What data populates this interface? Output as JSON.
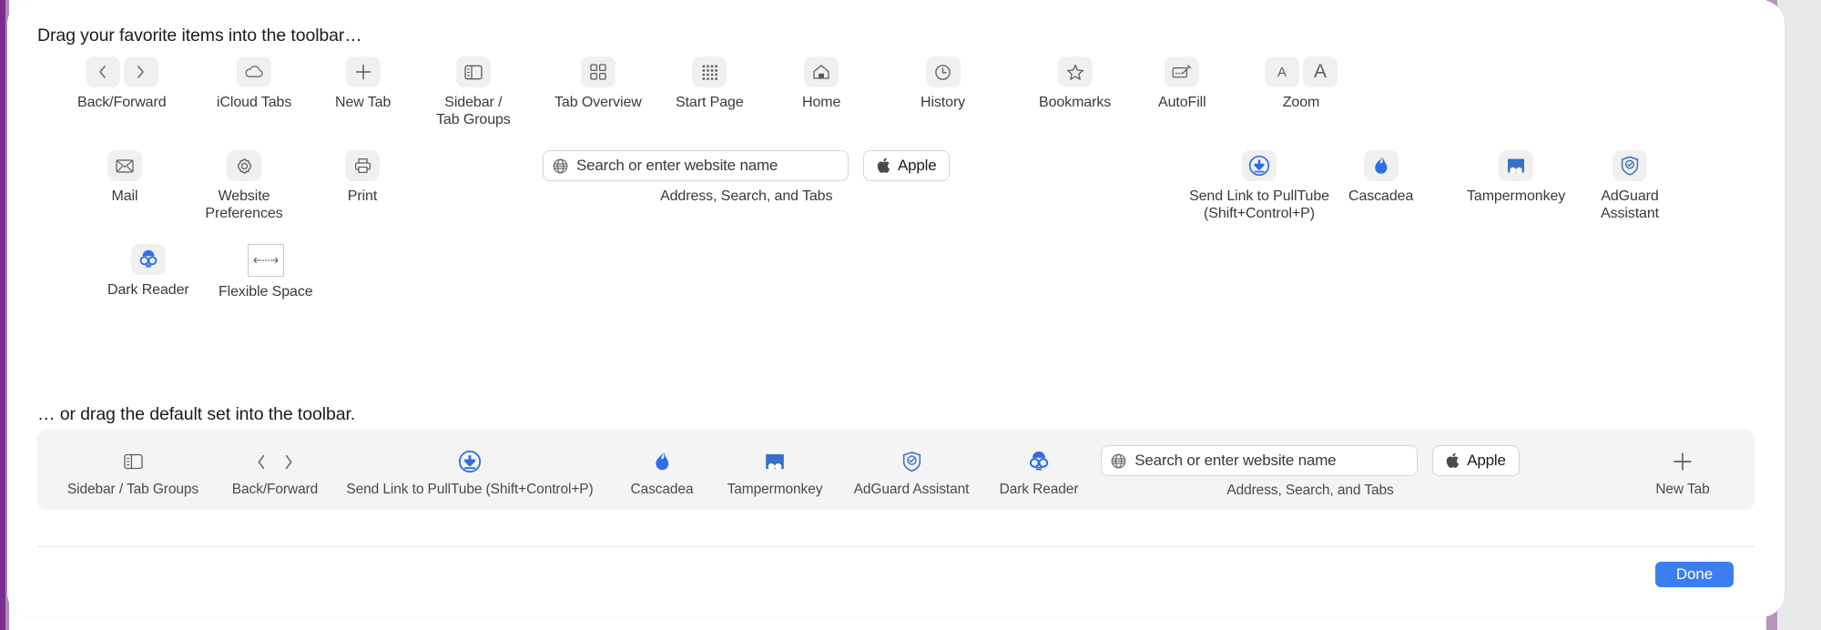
{
  "window": {
    "heading_favorites": "Drag your favorite items into the toolbar…",
    "heading_default": "… or drag the default set into the toolbar.",
    "done_label": "Done",
    "accent_color": "#3b7ef2",
    "chip_background": "#f0f0f0",
    "bar_background": "#f4f4f5",
    "backdrop_color": "#7b2d8f"
  },
  "palette": {
    "rows": [
      {
        "items": [
          {
            "label": "Back/Forward",
            "icon": "back-forward-chevrons-icon"
          },
          {
            "label": "iCloud Tabs",
            "icon": "cloud-icon"
          },
          {
            "label": "New Tab",
            "icon": "plus-icon"
          },
          {
            "label": "Sidebar /\nTab Groups",
            "icon": "sidebar-icon"
          },
          {
            "label": "Tab Overview",
            "icon": "grid-squares-icon"
          },
          {
            "label": "Start Page",
            "icon": "dot-grid-icon"
          },
          {
            "label": "Home",
            "icon": "home-icon"
          },
          {
            "label": "History",
            "icon": "clock-icon"
          },
          {
            "label": "Bookmarks",
            "icon": "star-icon"
          },
          {
            "label": "AutoFill",
            "icon": "autofill-card-pen-icon"
          },
          {
            "label": "Zoom",
            "icon": "zoom-small-a-large-a-icon"
          }
        ]
      },
      {
        "items": [
          {
            "label": "Mail",
            "icon": "envelope-icon"
          },
          {
            "label": "Website\nPreferences",
            "icon": "gear-icon"
          },
          {
            "label": "Print",
            "icon": "printer-icon"
          },
          {
            "label": "Address, Search, and Tabs",
            "icon": "globe-icon",
            "field_placeholder": "Search or enter website name",
            "button_label": "Apple",
            "button_icon": "apple-logo-icon"
          },
          {
            "label": "Send Link to PullTube\n(Shift+Control+P)",
            "icon": "pulltube-download-icon"
          },
          {
            "label": "Cascadea",
            "icon": "cascadea-drop-icon"
          },
          {
            "label": "Tampermonkey",
            "icon": "tampermonkey-icon"
          },
          {
            "label": "AdGuard\nAssistant",
            "icon": "adguard-shield-icon"
          }
        ]
      },
      {
        "items": [
          {
            "label": "Dark Reader",
            "icon": "dark-reader-goggles-icon"
          },
          {
            "label": "Flexible Space",
            "icon": "flexible-space-arrow-icon"
          }
        ]
      }
    ]
  },
  "default_set": {
    "items": [
      {
        "label": "Sidebar / Tab Groups",
        "icon": "sidebar-icon"
      },
      {
        "label": "Back/Forward",
        "icon": "back-forward-chevrons-icon"
      },
      {
        "label": "Send Link to PullTube (Shift+Control+P)",
        "icon": "pulltube-download-icon"
      },
      {
        "label": "Cascadea",
        "icon": "cascadea-drop-icon"
      },
      {
        "label": "Tampermonkey",
        "icon": "tampermonkey-icon"
      },
      {
        "label": "AdGuard Assistant",
        "icon": "adguard-shield-icon"
      },
      {
        "label": "Dark Reader",
        "icon": "dark-reader-goggles-icon"
      },
      {
        "label": "Address, Search, and Tabs",
        "icon": "globe-icon",
        "field_placeholder": "Search or enter website name",
        "button_label": "Apple",
        "button_icon": "apple-logo-icon"
      },
      {
        "label": "New Tab",
        "icon": "plus-icon"
      }
    ]
  }
}
